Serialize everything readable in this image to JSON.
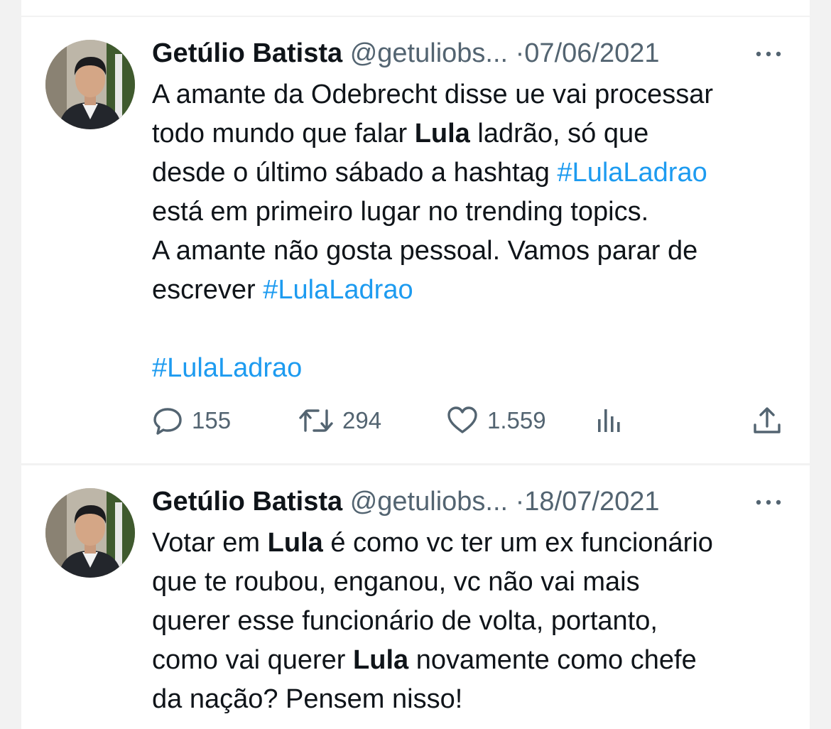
{
  "tweets": [
    {
      "name": "Getúlio Batista",
      "handle": "@getuliobs...",
      "separator": "·",
      "date": "07/06/2021",
      "body": [
        [
          "A amante da Odebrecht disse ue vai processar"
        ],
        [
          "todo mundo que falar ",
          "Lula",
          " ladrão, só que"
        ],
        [
          "desde o último sábado a hashtag ",
          "#LulaLadrao"
        ],
        [
          "está em primeiro lugar no trending topics."
        ],
        [
          "A amante não gosta pessoal. Vamos parar de"
        ],
        [
          "escrever ",
          "#LulaLadrao"
        ],
        [
          ""
        ],
        [
          "#LulaLadrao"
        ]
      ],
      "replies": "155",
      "retweets": "294",
      "likes": "1.559"
    },
    {
      "name": "Getúlio Batista",
      "handle": "@getuliobs...",
      "separator": "·",
      "date": "18/07/2021",
      "body": [
        [
          "Votar em ",
          "Lula",
          " é como vc ter um ex funcionário"
        ],
        [
          "que te roubou, enganou, vc não vai mais"
        ],
        [
          "querer esse funcionário de volta, portanto,"
        ],
        [
          "como vai querer ",
          "Lula",
          " novamente como chefe"
        ],
        [
          "da nação? Pensem nisso!"
        ]
      ]
    }
  ],
  "icons": {
    "more": "more-horizontal-icon",
    "reply": "reply-icon",
    "retweet": "retweet-icon",
    "like": "heart-icon",
    "views": "views-icon",
    "share": "share-icon"
  },
  "colors": {
    "text": "#0f1419",
    "muted": "#536471",
    "link": "#1d9bf0",
    "background": "#f2f2f2"
  }
}
